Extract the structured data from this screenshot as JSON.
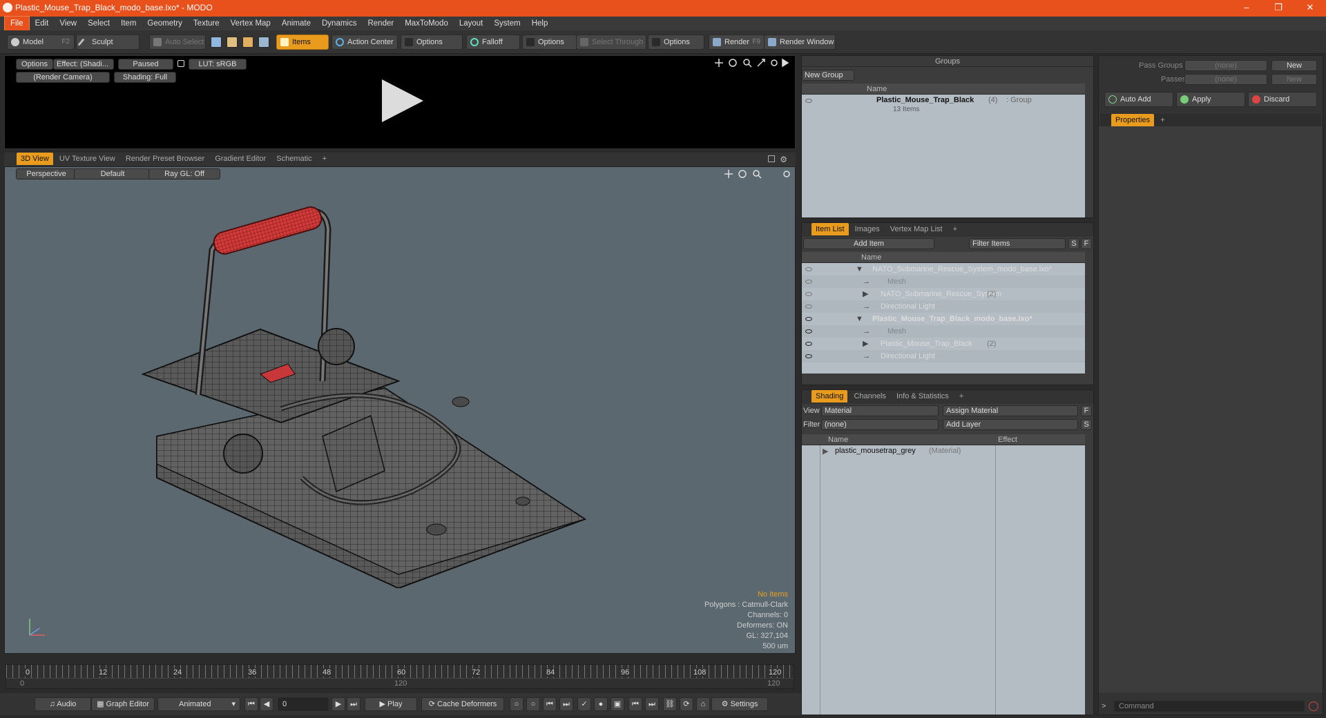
{
  "window": {
    "title": "Plastic_Mouse_Trap_Black_modo_base.lxo* - MODO",
    "minimize": "–",
    "maximize": "❐",
    "close": "✕"
  },
  "menu": [
    "File",
    "Edit",
    "View",
    "Select",
    "Item",
    "Geometry",
    "Texture",
    "Vertex Map",
    "Animate",
    "Dynamics",
    "Render",
    "MaxToModo",
    "Layout",
    "System",
    "Help"
  ],
  "toolbar": {
    "model": "Model",
    "model_key": "F2",
    "sculpt": "Sculpt",
    "auto_select": "Auto Select",
    "items": "Items",
    "action_center": "Action Center",
    "options1": "Options",
    "falloff": "Falloff",
    "options2": "Options",
    "select_through": "Select Through",
    "options3": "Options",
    "render": "Render",
    "render_key": "F9",
    "render_window": "Render Window"
  },
  "render_preview": {
    "options": "Options",
    "effect": "Effect: (Shadi...",
    "paused": "Paused",
    "lut": "LUT: sRGB",
    "camera": "(Render Camera)",
    "shading": "Shading: Full"
  },
  "viewport_tabs": [
    "3D View",
    "UV Texture View",
    "Render Preset Browser",
    "Gradient Editor",
    "Schematic",
    "+"
  ],
  "viewport": {
    "perspective": "Perspective",
    "default": "Default",
    "raygl": "Ray GL: Off",
    "info": {
      "no_items": "No Items",
      "polygons": "Polygons : Catmull-Clark",
      "channels": "Channels: 0",
      "deformers": "Deformers: ON",
      "gl": "GL: 327,104",
      "unit": "500 um"
    }
  },
  "groups": {
    "title": "Groups",
    "new_group": "New Group",
    "name_col": "Name",
    "item_name": "Plastic_Mouse_Trap_Black",
    "item_count": "(4)",
    "item_type": ": Group",
    "item_sub": "13 Items"
  },
  "item_list": {
    "tabs": [
      "Item List",
      "Images",
      "Vertex Map List",
      "+"
    ],
    "add_item": "Add Item",
    "filter": "Filter Items",
    "s": "S",
    "f": "F",
    "name_col": "Name",
    "rows": [
      {
        "label": "NATO_Submarine_Rescue_System_modo_base.lxo*",
        "indent": 0,
        "bold": false,
        "dim": false,
        "suffix": ""
      },
      {
        "label": "Mesh",
        "indent": 2,
        "bold": false,
        "dim": true,
        "suffix": ""
      },
      {
        "label": "NATO_Submarine_Rescue_System",
        "indent": 1,
        "bold": false,
        "dim": false,
        "suffix": "(2)"
      },
      {
        "label": "Directional Light",
        "indent": 1,
        "bold": false,
        "dim": false,
        "suffix": ""
      },
      {
        "label": "Plastic_Mouse_Trap_Black_modo_base.lxo*",
        "indent": 0,
        "bold": true,
        "dim": false,
        "suffix": ""
      },
      {
        "label": "Mesh",
        "indent": 2,
        "bold": false,
        "dim": true,
        "suffix": ""
      },
      {
        "label": "Plastic_Mouse_Trap_Black",
        "indent": 1,
        "bold": false,
        "dim": false,
        "suffix": "(2)"
      },
      {
        "label": "Directional Light",
        "indent": 1,
        "bold": false,
        "dim": false,
        "suffix": ""
      }
    ]
  },
  "shading": {
    "tabs": [
      "Shading",
      "Channels",
      "Info & Statistics",
      "+"
    ],
    "view_label": "View",
    "view_value": "Material",
    "assign": "Assign Material",
    "f": "F",
    "filter_label": "Filter",
    "filter_value": "(none)",
    "add_layer": "Add Layer",
    "s": "S",
    "name_col": "Name",
    "effect_col": "Effect",
    "row_name": "plastic_mousetrap_grey",
    "row_type": "(Material)"
  },
  "right": {
    "pass_groups": "Pass Groups",
    "passes": "Passes",
    "none1": "(none)",
    "none2": "(none)",
    "new1": "New",
    "new2": "New",
    "auto_add": "Auto Add",
    "apply": "Apply",
    "discard": "Discard",
    "properties": "Properties",
    "plus": "+",
    "command": "Command"
  },
  "timeline": {
    "ticks": [
      "0",
      "12",
      "24",
      "36",
      "48",
      "60",
      "72",
      "84",
      "96",
      "108",
      "120"
    ],
    "sub_start": "0",
    "sub_mid": "120",
    "sub_end": "120"
  },
  "bottom": {
    "audio": "Audio",
    "graph_editor": "Graph Editor",
    "animated": "Animated",
    "frame": "0",
    "play": "Play",
    "cache": "Cache Deformers",
    "settings": "Settings"
  },
  "colors": {
    "accent": "#e89b1c",
    "title": "#e8501c",
    "handle": "#d23a3a"
  }
}
